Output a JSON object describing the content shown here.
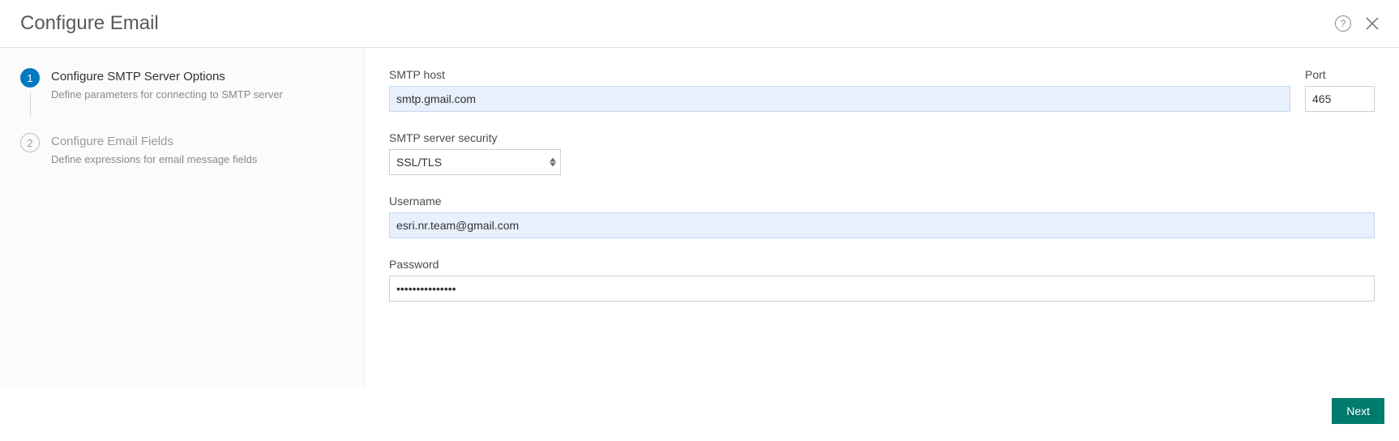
{
  "header": {
    "title": "Configure Email"
  },
  "steps": [
    {
      "number": "1",
      "title": "Configure SMTP Server Options",
      "desc": "Define parameters for connecting to SMTP server"
    },
    {
      "number": "2",
      "title": "Configure Email Fields",
      "desc": "Define expressions for email message fields"
    }
  ],
  "form": {
    "smtpHost": {
      "label": "SMTP host",
      "value": "smtp.gmail.com"
    },
    "port": {
      "label": "Port",
      "value": "465"
    },
    "security": {
      "label": "SMTP server security",
      "value": "SSL/TLS"
    },
    "username": {
      "label": "Username",
      "value": "esri.nr.team@gmail.com"
    },
    "password": {
      "label": "Password",
      "value": "•••••••••••••••"
    }
  },
  "footer": {
    "next": "Next"
  }
}
